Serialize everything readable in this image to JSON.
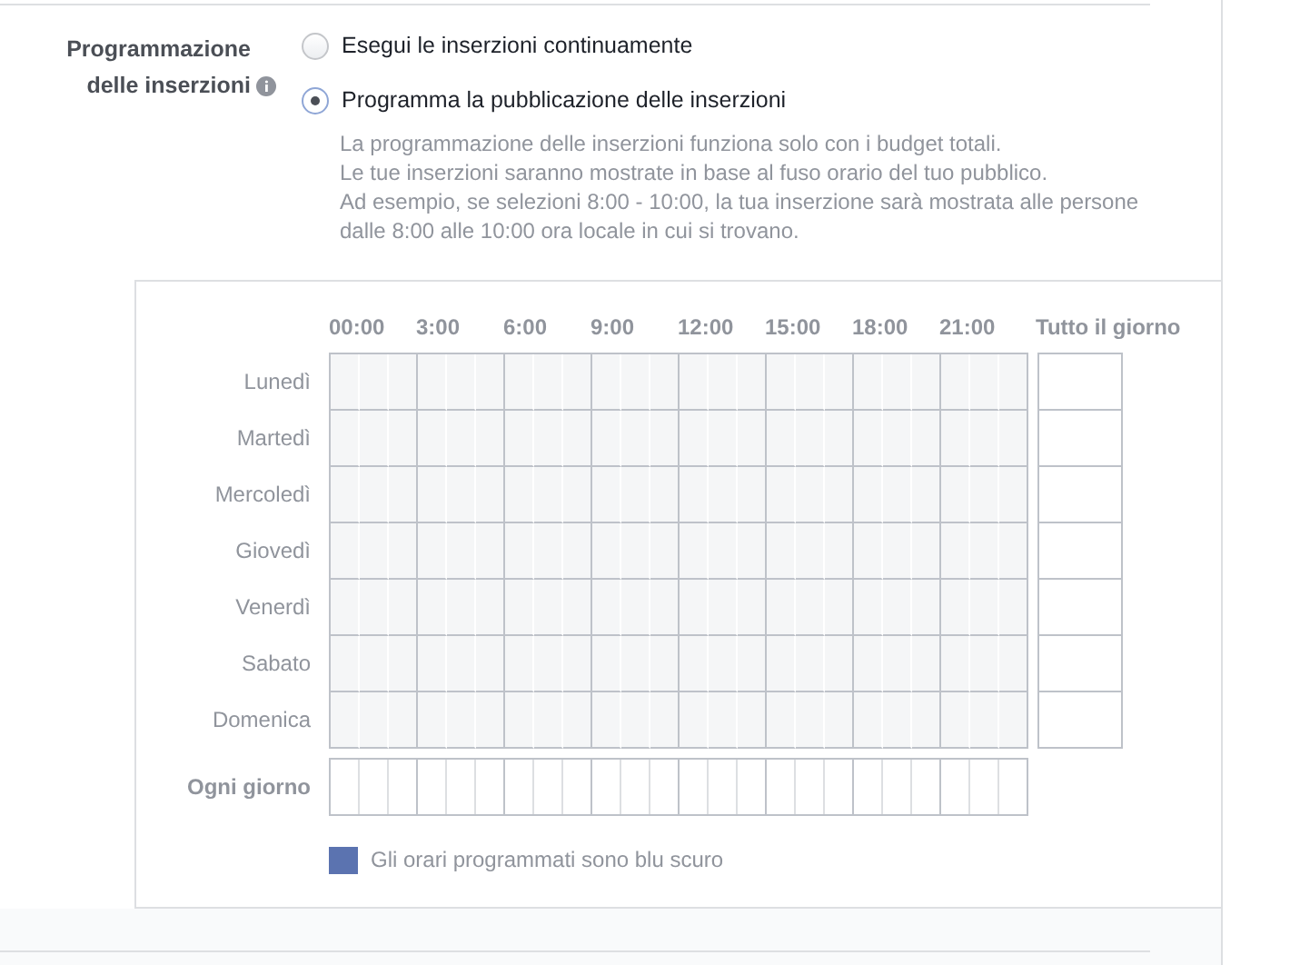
{
  "section": {
    "label": "Programmazione delle inserzioni"
  },
  "options": [
    {
      "label": "Esegui le inserzioni continuamente",
      "selected": false
    },
    {
      "label": "Programma la pubblicazione delle inserzioni",
      "selected": true
    }
  ],
  "description": [
    "La programmazione delle inserzioni funziona solo con i budget totali.",
    "Le tue inserzioni saranno mostrate in base al fuso orario del tuo pubblico.",
    "Ad esempio, se selezioni 8:00 - 10:00, la tua inserzione sarà mostrata alle persone",
    "dalle 8:00 alle 10:00 ora locale in cui si trovano."
  ],
  "schedule": {
    "hour_labels": [
      "00:00",
      "3:00",
      "6:00",
      "9:00",
      "12:00",
      "15:00",
      "18:00",
      "21:00"
    ],
    "all_day_label": "Tutto il giorno",
    "days": [
      "Lunedì",
      "Martedì",
      "Mercoledì",
      "Giovedì",
      "Venerdì",
      "Sabato",
      "Domenica"
    ],
    "every_day_label": "Ogni giorno",
    "legend": "Gli orari programmati sono blu scuro"
  }
}
